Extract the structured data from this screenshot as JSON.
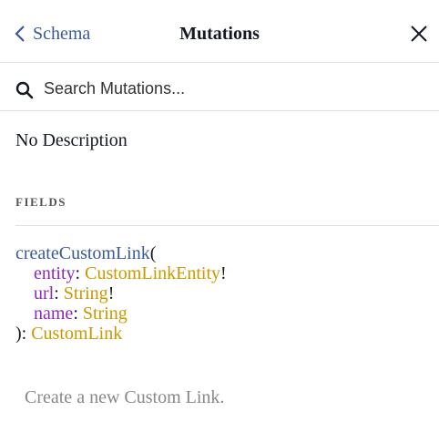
{
  "header": {
    "back_label": "Schema",
    "title": "Mutations"
  },
  "search": {
    "placeholder": "Search Mutations..."
  },
  "description": "No Description",
  "fields_title": "FIELDS",
  "field": {
    "name": "createCustomLink",
    "open_paren": "(",
    "args": [
      {
        "name": "entity",
        "type": "CustomLinkEntity",
        "suffix": "!"
      },
      {
        "name": "url",
        "type": "String",
        "suffix": "!"
      },
      {
        "name": "name",
        "type": "String",
        "suffix": ""
      }
    ],
    "close": "): ",
    "return_type": "CustomLink",
    "description": "Create a new Custom Link."
  },
  "colors": {
    "field_name": "#3b5998",
    "arg_name": "#8b2bb9",
    "type_name": "#ca9800"
  }
}
